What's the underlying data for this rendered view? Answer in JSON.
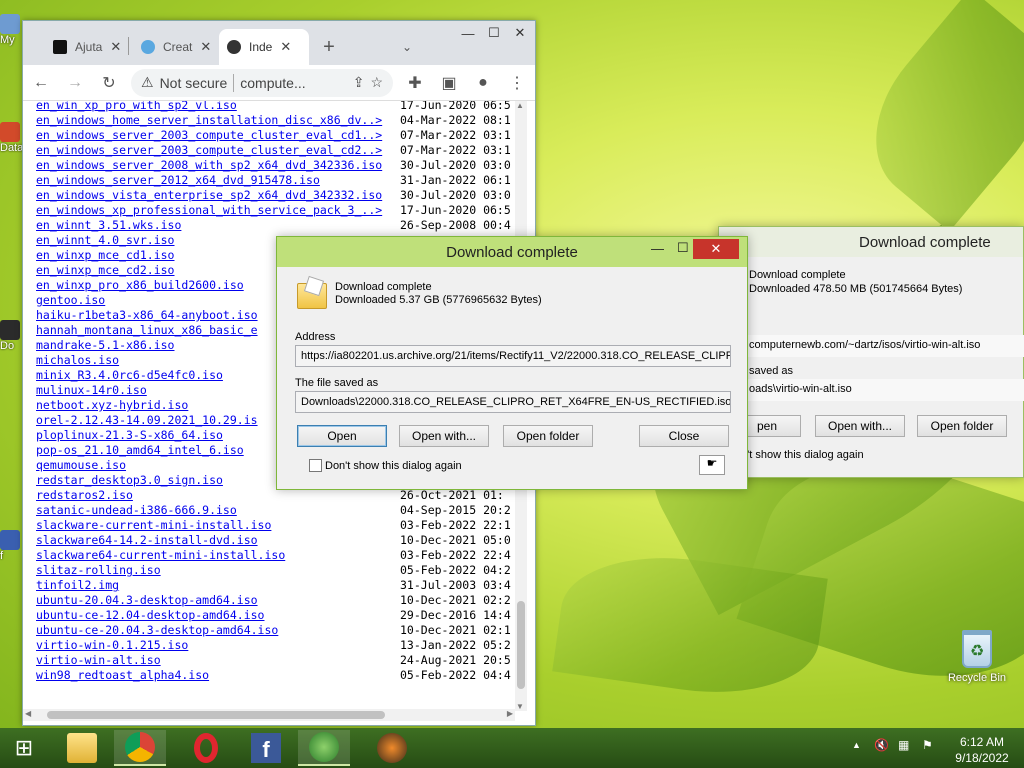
{
  "desktop": {
    "left_labels": [
      "My",
      "Data",
      "Do",
      "f"
    ],
    "recycle_bin": "Recycle Bin"
  },
  "browser": {
    "tabs": [
      {
        "label": "Ajuta",
        "icon": "bold-b-icon"
      },
      {
        "label": "Creat",
        "icon": "globe-icon"
      },
      {
        "label": "Inde",
        "icon": "archive-icon"
      }
    ],
    "address": {
      "security": "Not secure",
      "url": "compute..."
    },
    "files": [
      {
        "name": "en_win_xp_pro_with_sp2_vl.iso",
        "date": "17-Jun-2020 06:5"
      },
      {
        "name": "en_windows_home_server_installation_disc_x86_dv..>",
        "date": "04-Mar-2022 08:1"
      },
      {
        "name": "en_windows_server_2003_compute_cluster_eval_cd1..>",
        "date": "07-Mar-2022 03:1"
      },
      {
        "name": "en_windows_server_2003_compute_cluster_eval_cd2..>",
        "date": "07-Mar-2022 03:1"
      },
      {
        "name": "en_windows_server_2008_with_sp2_x64_dvd_342336.iso",
        "date": "30-Jul-2020 03:0"
      },
      {
        "name": "en_windows_server_2012_x64_dvd_915478.iso",
        "date": "31-Jan-2022 06:1"
      },
      {
        "name": "en_windows_vista_enterprise_sp2_x64_dvd_342332.iso",
        "date": "30-Jul-2020 03:0"
      },
      {
        "name": "en_windows_xp_professional_with_service_pack_3_..>",
        "date": "17-Jun-2020 06:5"
      },
      {
        "name": "en_winnt_3.51.wks.iso",
        "date": "26-Sep-2008 00:4"
      },
      {
        "name": "en_winnt_4.0_svr.iso",
        "date": ""
      },
      {
        "name": "en_winxp_mce_cd1.iso",
        "date": ""
      },
      {
        "name": "en_winxp_mce_cd2.iso",
        "date": ""
      },
      {
        "name": "en_winxp_pro_x86_build2600.iso",
        "date": ""
      },
      {
        "name": "gentoo.iso",
        "date": ""
      },
      {
        "name": "haiku-r1beta3-x86_64-anyboot.iso",
        "date": ""
      },
      {
        "name": "hannah_montana_linux_x86_basic_e",
        "date": ""
      },
      {
        "name": "mandrake-5.1-x86.iso",
        "date": ""
      },
      {
        "name": "michalos.iso",
        "date": ""
      },
      {
        "name": "minix_R3.4.0rc6-d5e4fc0.iso",
        "date": ""
      },
      {
        "name": "mulinux-14r0.iso",
        "date": ""
      },
      {
        "name": "netboot.xyz-hybrid.iso",
        "date": ""
      },
      {
        "name": "orel-2.12.43-14.09.2021_10.29.is",
        "date": ""
      },
      {
        "name": "ploplinux-21.3-S-x86_64.iso",
        "date": ""
      },
      {
        "name": "pop-os_21.10_amd64_intel_6.iso",
        "date": ""
      },
      {
        "name": "qemumouse.iso",
        "date": ""
      },
      {
        "name": "redstar_desktop3.0_sign.iso",
        "date": ""
      },
      {
        "name": "redstaros2.iso",
        "date": "26-Oct-2021 01:"
      },
      {
        "name": "satanic-undead-i386-666.9.iso",
        "date": "04-Sep-2015 20:2"
      },
      {
        "name": "slackware-current-mini-install.iso",
        "date": "03-Feb-2022 22:1"
      },
      {
        "name": "slackware64-14.2-install-dvd.iso",
        "date": "10-Dec-2021 05:0"
      },
      {
        "name": "slackware64-current-mini-install.iso",
        "date": "03-Feb-2022 22:4"
      },
      {
        "name": "slitaz-rolling.iso",
        "date": "05-Feb-2022 04:2"
      },
      {
        "name": "tinfoil2.img",
        "date": "31-Jul-2003 03:4"
      },
      {
        "name": "ubuntu-20.04.3-desktop-amd64.iso",
        "date": "10-Dec-2021 02:2"
      },
      {
        "name": "ubuntu-ce-12.04-desktop-amd64.iso",
        "date": "29-Dec-2016 14:4"
      },
      {
        "name": "ubuntu-ce-20.04.3-desktop-amd64.iso",
        "date": "10-Dec-2021 02:1"
      },
      {
        "name": "virtio-win-0.1.215.iso",
        "date": "13-Jan-2022 05:2"
      },
      {
        "name": "virtio-win-alt.iso",
        "date": "24-Aug-2021 20:5"
      },
      {
        "name": "win98_redtoast_alpha4.iso",
        "date": "05-Feb-2022 04:4"
      }
    ]
  },
  "dialog_main": {
    "title": "Download complete",
    "heading": "Download complete",
    "downloaded": "Downloaded 5.37  GB (5776965632 Bytes)",
    "address_label": "Address",
    "address_value": "https://ia802201.us.archive.org/21/items/Rectify11_V2/22000.318.CO_RELEASE_CLIPR",
    "saved_label": "The file saved as",
    "saved_value": "Downloads\\22000.318.CO_RELEASE_CLIPRO_RET_X64FRE_EN-US_RECTIFIED.iso",
    "open": "Open",
    "open_with": "Open with...",
    "open_folder": "Open folder",
    "close": "Close",
    "dont_show": "Don't show this dialog again"
  },
  "dialog_back": {
    "title": "Download complete",
    "heading": "Download complete",
    "downloaded": "Downloaded 478.50  MB (501745664 Bytes)",
    "address_value": "computernewb.com/~dartz/isos/virtio-win-alt.iso",
    "saved_label": "saved as",
    "saved_value": "oads\\virtio-win-alt.iso",
    "open": "pen",
    "open_with": "Open with...",
    "open_folder": "Open folder",
    "dont_show": "n't show this dialog again"
  },
  "tray": {
    "time": "6:12 AM",
    "date": "9/18/2022"
  }
}
